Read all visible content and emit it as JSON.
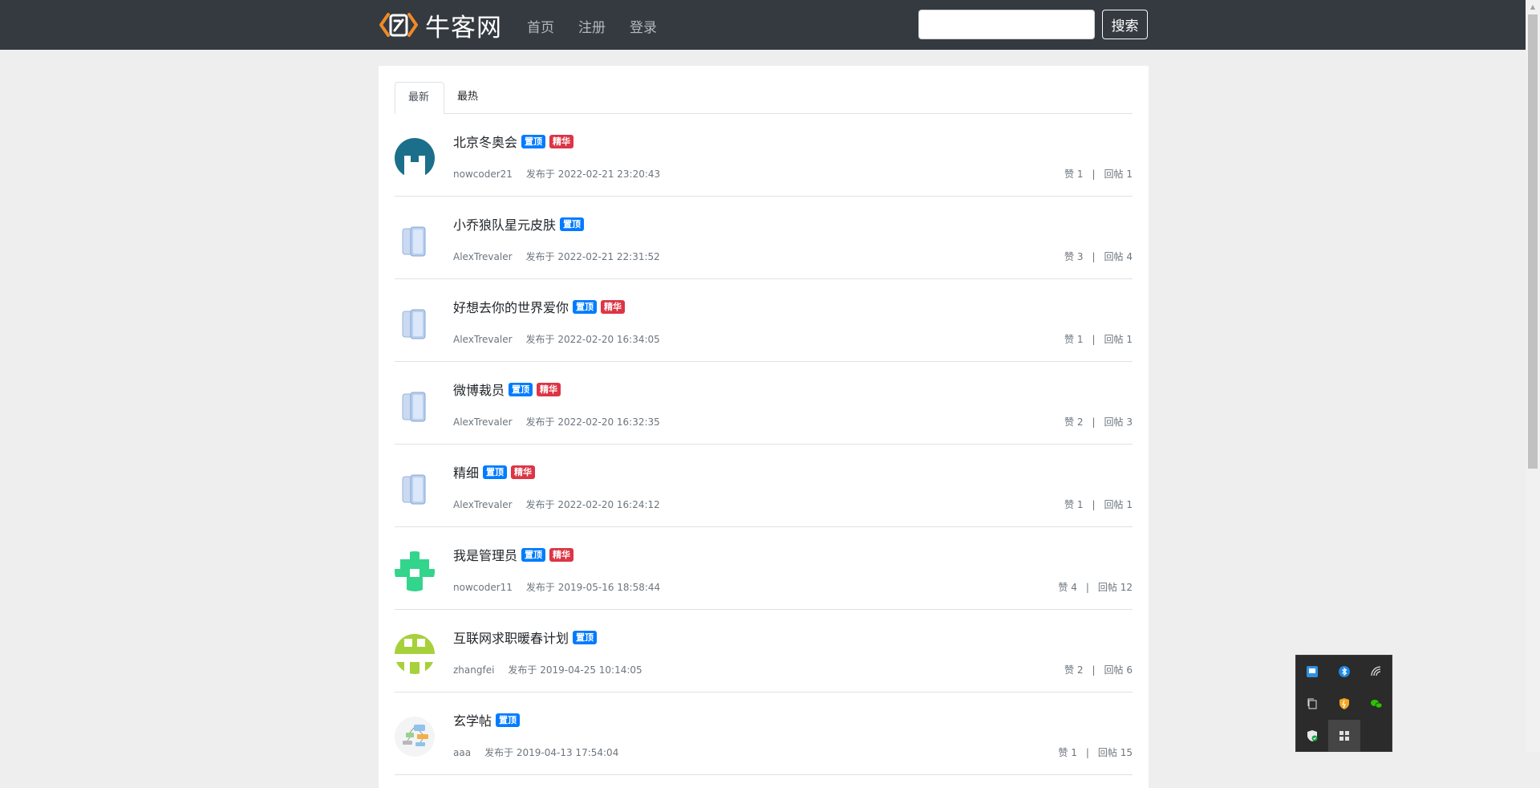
{
  "header": {
    "brand": "牛客网",
    "nav": [
      "首页",
      "注册",
      "登录"
    ],
    "search_placeholder": "",
    "search_button": "搜索"
  },
  "tabs": [
    "最新",
    "最热"
  ],
  "badges": {
    "top": "置顶",
    "elite": "精华"
  },
  "posts": [
    {
      "title": "北京冬奥会",
      "top": true,
      "elite": true,
      "author": "nowcoder21",
      "time": "发布于 2022-02-21 23:20:43",
      "likes": "赞 1",
      "replies": "回帖 1"
    },
    {
      "title": "小乔狼队星元皮肤",
      "top": true,
      "elite": false,
      "author": "AlexTrevaler",
      "time": "发布于 2022-02-21 22:31:52",
      "likes": "赞 3",
      "replies": "回帖 4"
    },
    {
      "title": "好想去你的世界爱你",
      "top": true,
      "elite": true,
      "author": "AlexTrevaler",
      "time": "发布于 2022-02-20 16:34:05",
      "likes": "赞 1",
      "replies": "回帖 1"
    },
    {
      "title": "微博裁员",
      "top": true,
      "elite": true,
      "author": "AlexTrevaler",
      "time": "发布于 2022-02-20 16:32:35",
      "likes": "赞 2",
      "replies": "回帖 3"
    },
    {
      "title": "精细",
      "top": true,
      "elite": true,
      "author": "AlexTrevaler",
      "time": "发布于 2022-02-20 16:24:12",
      "likes": "赞 1",
      "replies": "回帖 1"
    },
    {
      "title": "我是管理员",
      "top": true,
      "elite": true,
      "author": "nowcoder11",
      "time": "发布于 2019-05-16 18:58:44",
      "likes": "赞 4",
      "replies": "回帖 12"
    },
    {
      "title": "互联网求职暖春计划",
      "top": true,
      "elite": false,
      "author": "zhangfei",
      "time": "发布于 2019-04-25 10:14:05",
      "likes": "赞 2",
      "replies": "回帖 6"
    },
    {
      "title": "玄学帖",
      "top": true,
      "elite": false,
      "author": "aaa",
      "time": "发布于 2019-04-13 17:54:04",
      "likes": "赞 1",
      "replies": "回帖 15"
    }
  ],
  "stats_separator": "|",
  "colors": {
    "navbar": "#343a40",
    "badge_top": "#007bff",
    "badge_elite": "#dc3545"
  }
}
